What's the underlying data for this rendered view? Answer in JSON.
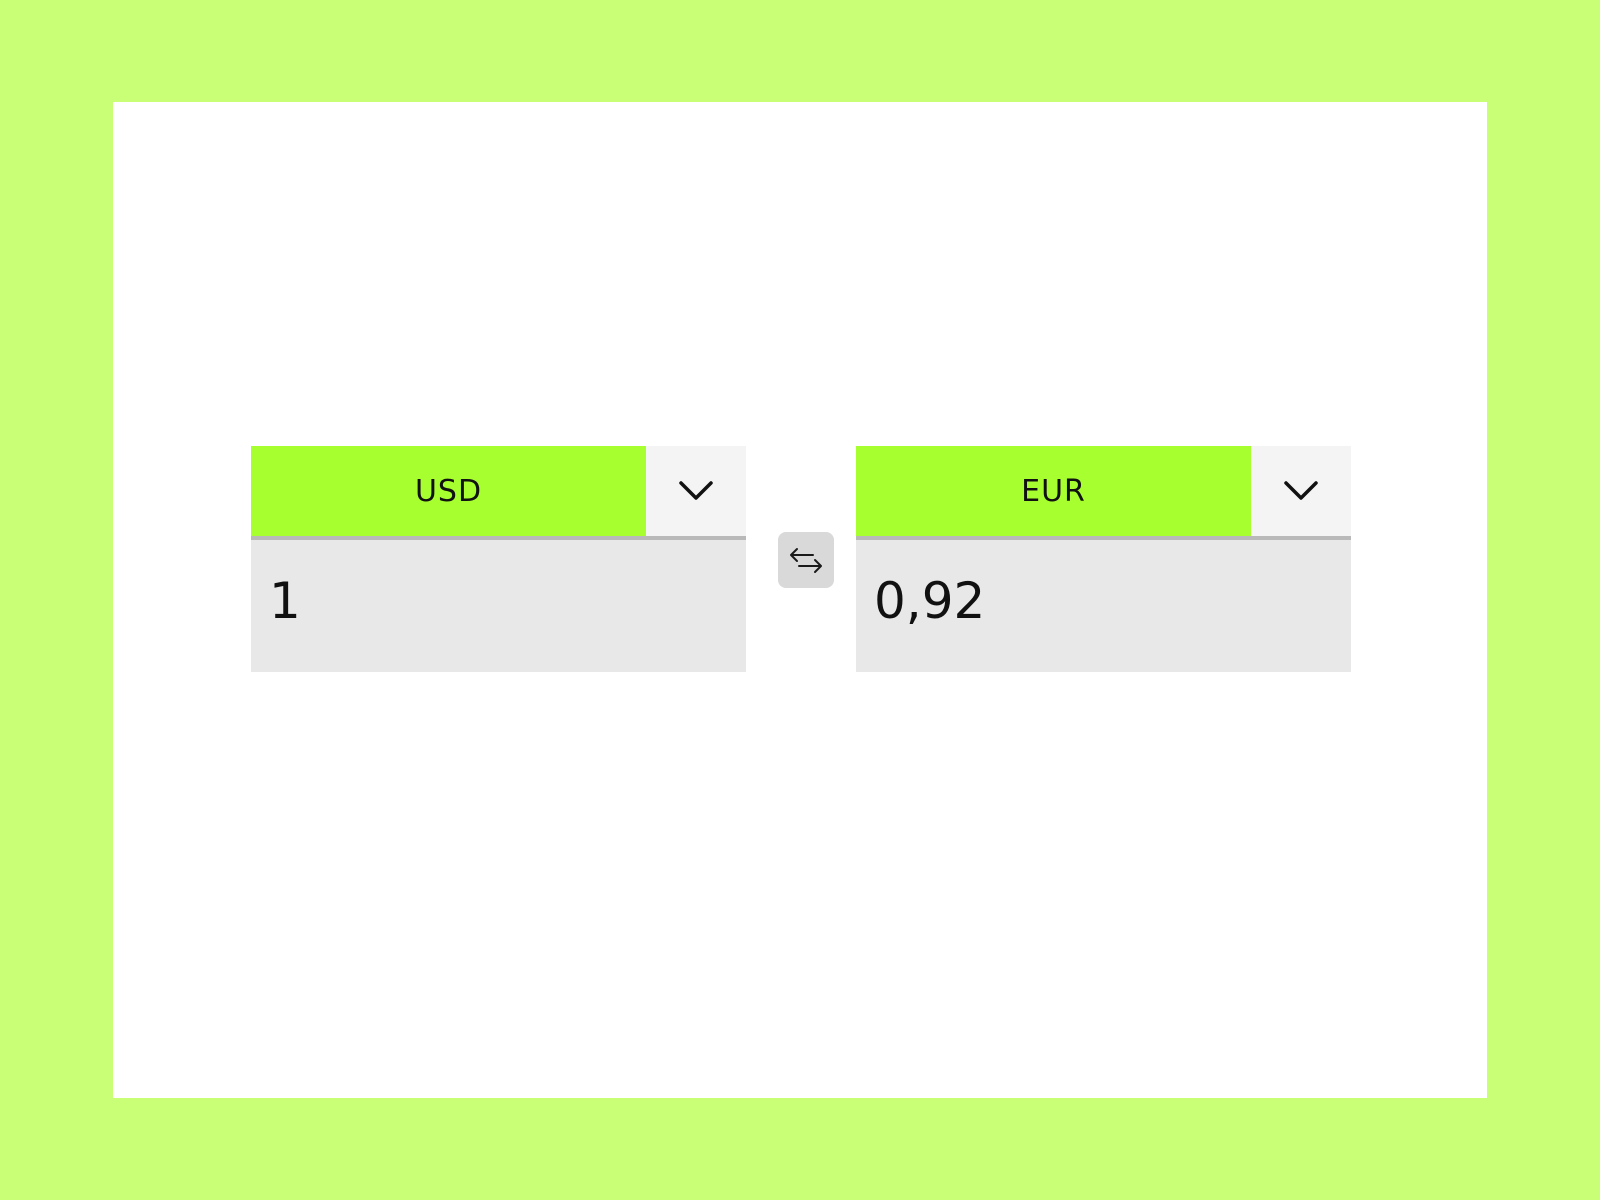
{
  "converter": {
    "from": {
      "currency": "USD",
      "amount": "1"
    },
    "to": {
      "currency": "EUR",
      "amount": "0,92"
    },
    "icons": {
      "dropdown": "chevron-down-icon",
      "swap": "swap-arrows-icon"
    },
    "colors": {
      "page_background": "#c8ff76",
      "card_background": "#ffffff",
      "currency_button": "#a8ff2f",
      "dropdown_button": "#f4f4f4",
      "amount_background": "#e8e8e8",
      "swap_button": "#d9d9d9"
    }
  }
}
